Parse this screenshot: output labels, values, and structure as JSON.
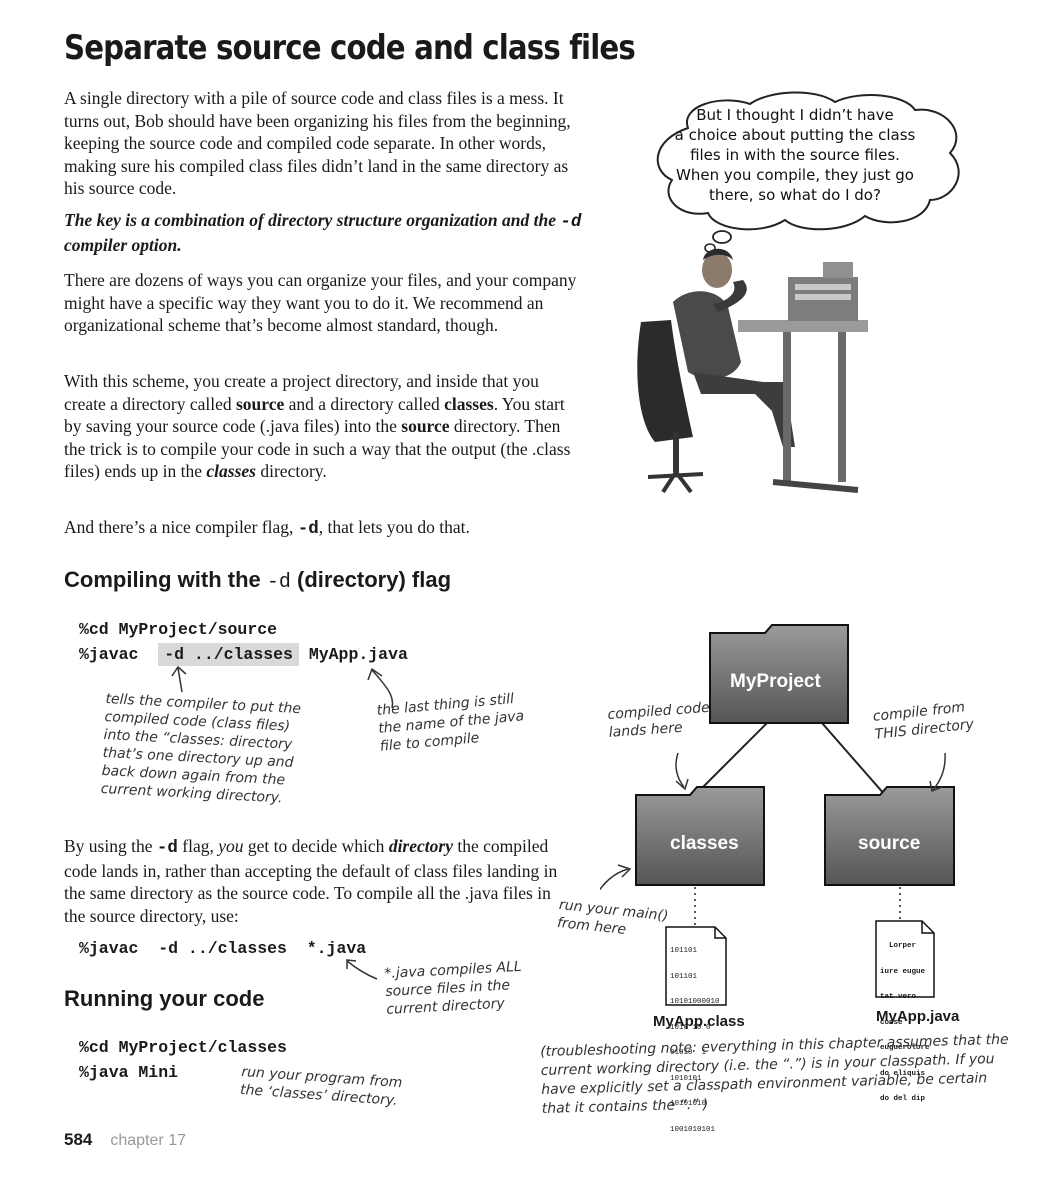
{
  "page": {
    "title": "Separate source code and class files",
    "intro": "A single directory with a pile of source code and class files is a mess. It turns out, Bob should have been organizing his files from the beginning, keeping the source code and compiled code separate. In other words, making sure his compiled class files didn’t land in the same directory as his source code.",
    "key_line_a": "The key is a combination of directory structure organization and the",
    "key_line_flag": "-d",
    "key_line_b": "compiler option.",
    "dozens": "There are dozens of ways you can organize your files, and your company might have a specific way they want you to do it. We recommend an organizational scheme that’s become almost standard, though.",
    "scheme": {
      "t1": "With this scheme, you create a project directory, and inside that you create a directory called ",
      "b1": "source",
      "t2": " and a directory called ",
      "b2": "classes",
      "t3": ". You start by saving your source code (.java files) into the ",
      "b3": "source",
      "t4": " directory. Then the trick is to compile your code in such a way that the output (the .class files) ends up in the ",
      "b4": "classes",
      "t5": " directory."
    },
    "flag_line": {
      "t1": "And there’s a nice compiler flag, ",
      "flag": "-d",
      "t2": ", that lets you do that."
    }
  },
  "bubble": {
    "lines": [
      "But I thought I didn’t have",
      "a choice about putting the class",
      "files in with the source files.",
      "When you compile, they just go",
      "there, so what do I do?"
    ]
  },
  "section_compile": {
    "heading_a": "Compiling with the ",
    "heading_flag": "-d",
    "heading_b": " (directory) flag",
    "cmd1": "%cd MyProject/source",
    "cmd2_a": "%javac ",
    "cmd2_hl": "-d ../classes",
    "cmd2_b": " MyApp.java",
    "note_left": [
      "tells the compiler to put the",
      "compiled code (class files)",
      "into the “classes: directory",
      "that’s one directory up and",
      "back down again from the",
      "current working directory."
    ],
    "note_right": [
      "the last thing is still",
      "the name of the java",
      "file to compile"
    ]
  },
  "using": {
    "t1": "By using the ",
    "flag": "-d",
    "t2": " flag, ",
    "you": "you",
    "t3": " get to decide which ",
    "directory": "directory",
    "t4": " the compiled code lands in, rather than accepting the default of class files landing in the same directory as the source code. To compile all the .java files in the source directory, use:",
    "cmd": "%javac  -d ../classes  *.java",
    "note": [
      "*.java compiles ALL",
      "source files in the",
      "current directory"
    ]
  },
  "section_run": {
    "heading": "Running your code",
    "cmd1": "%cd MyProject/classes",
    "cmd2": "%java Mini",
    "note": [
      "run your program from",
      "the ‘classes’ directory."
    ]
  },
  "diagram": {
    "folder_root": "MyProject",
    "folder_classes": "classes",
    "folder_source": "source",
    "note_compiled": [
      "compiled code",
      "lands here"
    ],
    "note_compile_from": [
      "compile from",
      "THIS directory"
    ],
    "note_run": [
      "run your main()",
      "from here"
    ],
    "class_file_label": "MyApp.class",
    "java_file_label": "MyApp.java",
    "class_file_lines": [
      "101101",
      "101101",
      "10101000010",
      "1010 10 0",
      "01010  1",
      "1010101",
      "10101010",
      "1001010101"
    ],
    "java_file_lines": [
      "  Lorper",
      "iure eugue",
      "tat vero",
      "conse",
      "euguerolore",
      "do eliquis",
      "do del dip"
    ]
  },
  "troubleshoot": [
    "(troubleshooting note: everything in this chapter assumes that the",
    "current working directory (i.e. the “.”) is in your classpath. If you",
    "have explicitly set a classpath environment variable, be certain",
    "that it contains the “.” )"
  ],
  "footer": {
    "page_number": "584",
    "chapter": "chapter 17"
  }
}
